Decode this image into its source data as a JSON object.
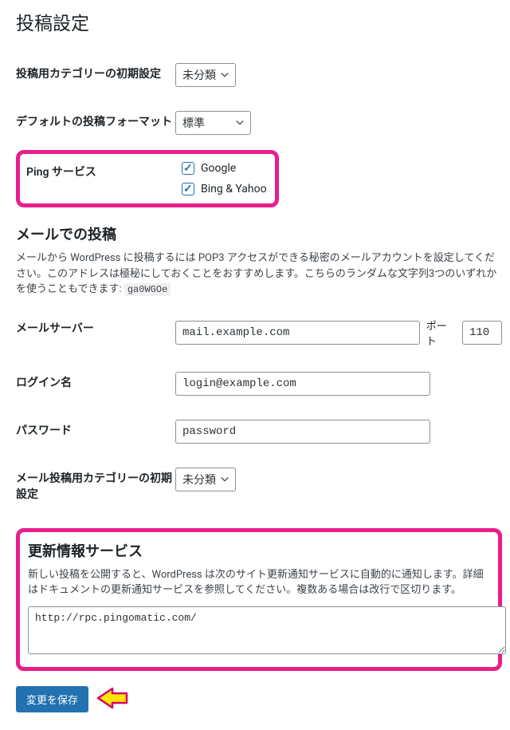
{
  "page": {
    "title": "投稿設定"
  },
  "default_category": {
    "label": "投稿用カテゴリーの初期設定",
    "selected": "未分類"
  },
  "default_format": {
    "label": "デフォルトの投稿フォーマット",
    "selected": "標準"
  },
  "ping": {
    "label": "Ping サービス",
    "options": [
      {
        "label": "Google",
        "checked": true
      },
      {
        "label": "Bing & Yahoo",
        "checked": true
      }
    ]
  },
  "mail_section": {
    "title": "メールでの投稿",
    "description_a": "メールから WordPress に投稿するには POP3 アクセスができる秘密のメールアカウントを設定してください。このアドレスは極秘にしておくことをおすすめします。こちらのランダムな文字列3つのいずれかを使うこともできます: ",
    "random_code": "ga0WGOe"
  },
  "mail_server": {
    "label": "メールサーバー",
    "value": "mail.example.com",
    "port_label": "ポート",
    "port_value": "110"
  },
  "login": {
    "label": "ログイン名",
    "value": "login@example.com"
  },
  "password": {
    "label": "パスワード",
    "value": "password"
  },
  "mail_category": {
    "label": "メール投稿用カテゴリーの初期設定",
    "selected": "未分類"
  },
  "update_services": {
    "title": "更新情報サービス",
    "description": "新しい投稿を公開すると、WordPress は次のサイト更新通知サービスに自動的に通知します。詳細はドキュメントの更新通知サービスを参照してください。複数ある場合は改行で区切ります。",
    "value": "http://rpc.pingomatic.com/"
  },
  "submit": {
    "label": "変更を保存"
  }
}
